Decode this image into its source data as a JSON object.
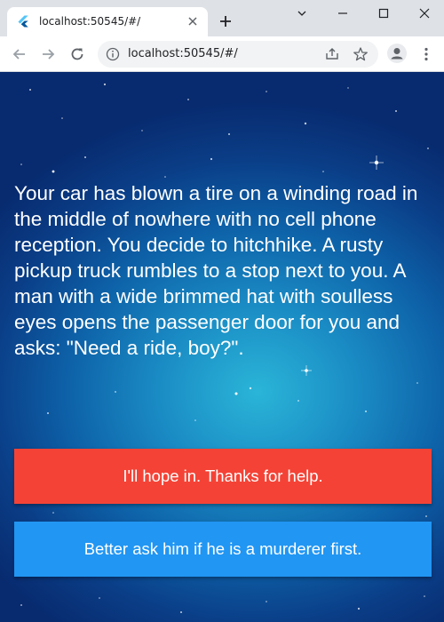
{
  "browser": {
    "tab": {
      "title": "localhost:50545/#/",
      "favicon": "flutter-icon"
    },
    "address_bar": {
      "url": "localhost:50545/#/"
    },
    "icons": [
      "back-arrow-icon",
      "forward-arrow-icon",
      "reload-icon",
      "info-icon",
      "share-icon",
      "star-icon",
      "profile-icon",
      "menu-dots-icon",
      "new-tab-icon",
      "minimize-icon",
      "maximize-icon",
      "close-icon",
      "tab-list-chevron-icon"
    ]
  },
  "story": {
    "text": "Your car has blown a tire on a winding road in the middle of nowhere with no cell phone reception. You decide to hitchhike. A rusty pickup truck rumbles to a stop next to you. A man with a wide brimmed hat with soulless eyes opens the passenger door for you and asks: \"Need a ride, boy?\"."
  },
  "choices": [
    {
      "label": "I'll hope in. Thanks for help.",
      "color": "#f44336"
    },
    {
      "label": "Better ask him if he is a murderer first.",
      "color": "#2196f3"
    }
  ],
  "colors": {
    "background_center": "#2ab5d8",
    "background_edge": "#082a6e",
    "text": "#ffffff"
  }
}
